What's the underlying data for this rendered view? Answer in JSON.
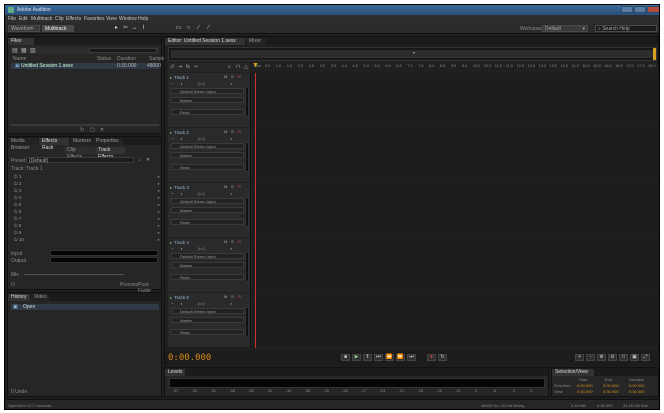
{
  "window": {
    "title": "Adobe Audition",
    "app_icon": "audition-icon"
  },
  "menu": [
    "File",
    "Edit",
    "Multitrack",
    "Clip",
    "Effects",
    "Favorites",
    "View",
    "Window",
    "Help"
  ],
  "toolbar": {
    "waveform_label": "Waveform",
    "multitrack_label": "Multitrack",
    "workspace_label": "Workspace:",
    "workspace_value": "Default",
    "search_placeholder": "Search Help"
  },
  "files_panel": {
    "tab": "Files",
    "columns": [
      "Name",
      "Status",
      "Duration",
      "Sample"
    ],
    "items": [
      {
        "name": "Untitled Session 1.sesx",
        "duration": "0:30.000",
        "sample": "48000"
      }
    ]
  },
  "effects_panel": {
    "tabs": [
      "Media Browser",
      "Effects Rack",
      "Markers",
      "Properties"
    ],
    "subtabs": [
      "Clip Effects",
      "Track Effects"
    ],
    "presets_label": "Presets:",
    "presets_value": "(Default)",
    "track_label": "Track: Track 1",
    "slots": [
      "1",
      "2",
      "3",
      "4",
      "5",
      "6",
      "7",
      "8",
      "9",
      "10"
    ],
    "mix_input_label": "Input",
    "mix_output_label": "Output",
    "mix_label": "Mix",
    "process_label": "Process:",
    "process_value": "Post-Fader"
  },
  "history_panel": {
    "tabs": [
      "History",
      "Video"
    ],
    "item": "Open",
    "undo_label": "0 Undo"
  },
  "editor": {
    "tab_label": "Editor: Untitled Session 1.sesx",
    "mixer_tab": "Mixer",
    "ruler_ticks": [
      "hms",
      "0.5",
      "1.0",
      "1.5",
      "2.0",
      "2.5",
      "3.0",
      "3.5",
      "4.0",
      "4.5",
      "5.0",
      "5.5",
      "6.0",
      "6.5",
      "7.0",
      "7.5",
      "8.0",
      "8.5",
      "9.0",
      "9.5",
      "10.0",
      "10.5",
      "11.0",
      "11.5",
      "12.0",
      "12.5",
      "13.0",
      "13.5",
      "14.0",
      "14.5",
      "15.0",
      "15.5",
      "16.0",
      "16.5",
      "17.0",
      "17.5",
      "18.0"
    ],
    "tracks": [
      {
        "name": "Track 1",
        "input": "Default Stereo Input",
        "output": "Master",
        "read": "Read"
      },
      {
        "name": "Track 2",
        "input": "Default Stereo Input",
        "output": "Master",
        "read": "Read"
      },
      {
        "name": "Track 3",
        "input": "Default Stereo Input",
        "output": "Master",
        "read": "Read"
      },
      {
        "name": "Track 4",
        "input": "Default Stereo Input",
        "output": "Master",
        "read": "Read"
      },
      {
        "name": "Track 5",
        "input": "Default Stereo Input",
        "output": "Master",
        "read": "Read"
      }
    ],
    "timecode": "0:00.000"
  },
  "levels_panel": {
    "tab": "Levels",
    "scale": [
      "-57",
      "-54",
      "-51",
      "-48",
      "-45",
      "-42",
      "-39",
      "-36",
      "-33",
      "-30",
      "-27",
      "-24",
      "-21",
      "-18",
      "-15",
      "-12",
      "-9",
      "-6",
      "-3",
      "0"
    ]
  },
  "selection_panel": {
    "tab": "Selection/View",
    "columns": [
      "Start",
      "End",
      "Duration"
    ],
    "rows": [
      {
        "label": "Selection",
        "start": "0:00.000",
        "end": "0:00.000",
        "duration": "0:00.000"
      },
      {
        "label": "View",
        "start": "0:00.000",
        "end": "0:30.000",
        "duration": "0:30.000"
      }
    ]
  },
  "status": {
    "left": "Opened in 0.17 seconds",
    "sample": "48000 Hz • 32-bit Mixing",
    "size": "5.49 MB",
    "duration": "0:30.000",
    "free": "31.90 GB free"
  }
}
